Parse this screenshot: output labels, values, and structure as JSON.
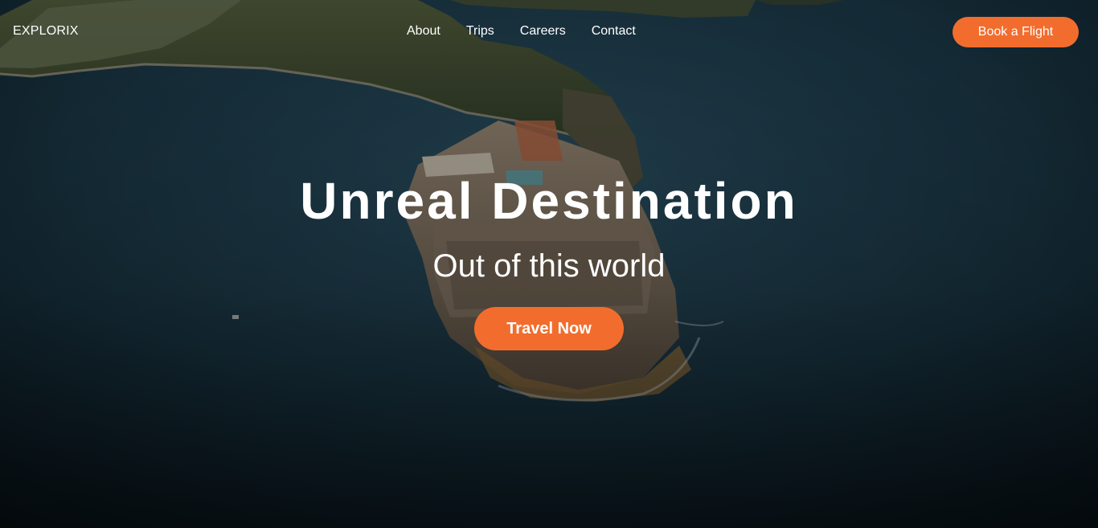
{
  "nav": {
    "logo": "EXPLORIX",
    "links": [
      "About",
      "Trips",
      "Careers",
      "Contact"
    ],
    "cta_label": "Book a Flight"
  },
  "hero": {
    "title": "Unreal Destination",
    "subtitle": "Out of this world",
    "cta_label": "Travel Now",
    "background": "aerial-photo-island-fortress-in-sea"
  },
  "colors": {
    "accent": "#f26d2d",
    "text": "#ffffff",
    "sea": "#16303d"
  }
}
